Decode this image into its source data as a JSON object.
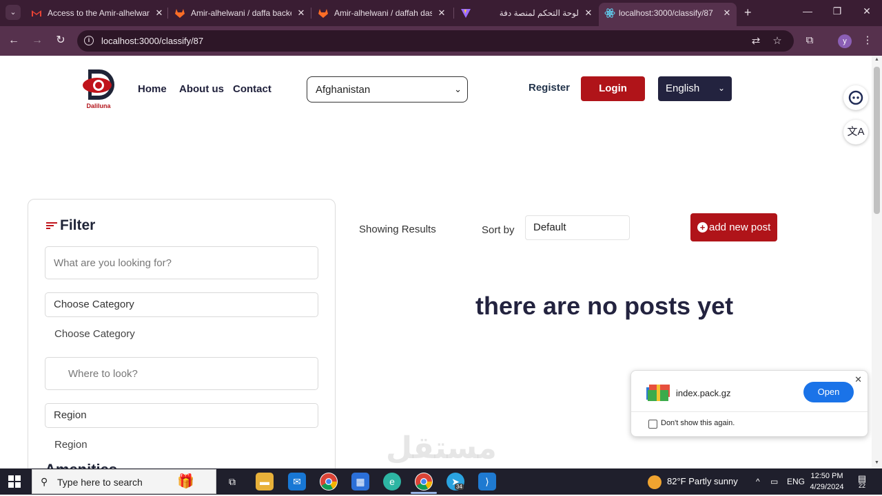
{
  "browser": {
    "tabs": [
      {
        "title": "Access to the Amir-alhelwani",
        "favicon": "gmail-icon",
        "active": false
      },
      {
        "title": "Amir-alhelwani / daffa backe",
        "favicon": "gitlab-icon",
        "active": false
      },
      {
        "title": "Amir-alhelwani / daffah dash",
        "favicon": "gitlab-icon",
        "active": false
      },
      {
        "title": "لوحة التحكم لمنصة دفة",
        "favicon": "vite-icon",
        "active": false
      },
      {
        "title": "localhost:3000/classify/87",
        "favicon": "react-icon",
        "active": true
      }
    ],
    "url": "localhost:3000/classify/87",
    "profile_initial": "y"
  },
  "site": {
    "logo_text": "Daliluna",
    "nav": {
      "home": "Home",
      "about": "About us",
      "contact": "Contact"
    },
    "country_select": "Afghanistan",
    "register": "Register",
    "login": "Login",
    "language": "English"
  },
  "filter": {
    "title": "Filter",
    "search_placeholder": "What are you looking for?",
    "category_select": "Choose Category",
    "category_label": "Choose Category",
    "location_placeholder": "Where to look?",
    "region_select": "Region",
    "region_label": "Region",
    "cut_heading": "Amenities"
  },
  "results": {
    "showing": "Showing Results",
    "sort_label": "Sort by",
    "sort_value": "Default",
    "add_post": "add new post",
    "empty_message": "there are no posts yet"
  },
  "download": {
    "filename": "index.pack.gz",
    "open_label": "Open",
    "dont_show": "Don't show this again."
  },
  "watermark": "مستقل",
  "taskbar": {
    "search_placeholder": "Type here to search",
    "weather": "82°F  Partly sunny",
    "language": "ENG",
    "time": "12:50 PM",
    "date": "4/29/2024",
    "notifications": "22",
    "telegram_badge": "34"
  },
  "colors": {
    "brand_red": "#b01419",
    "navy": "#23233f",
    "browser_frame": "#3a1d33"
  }
}
